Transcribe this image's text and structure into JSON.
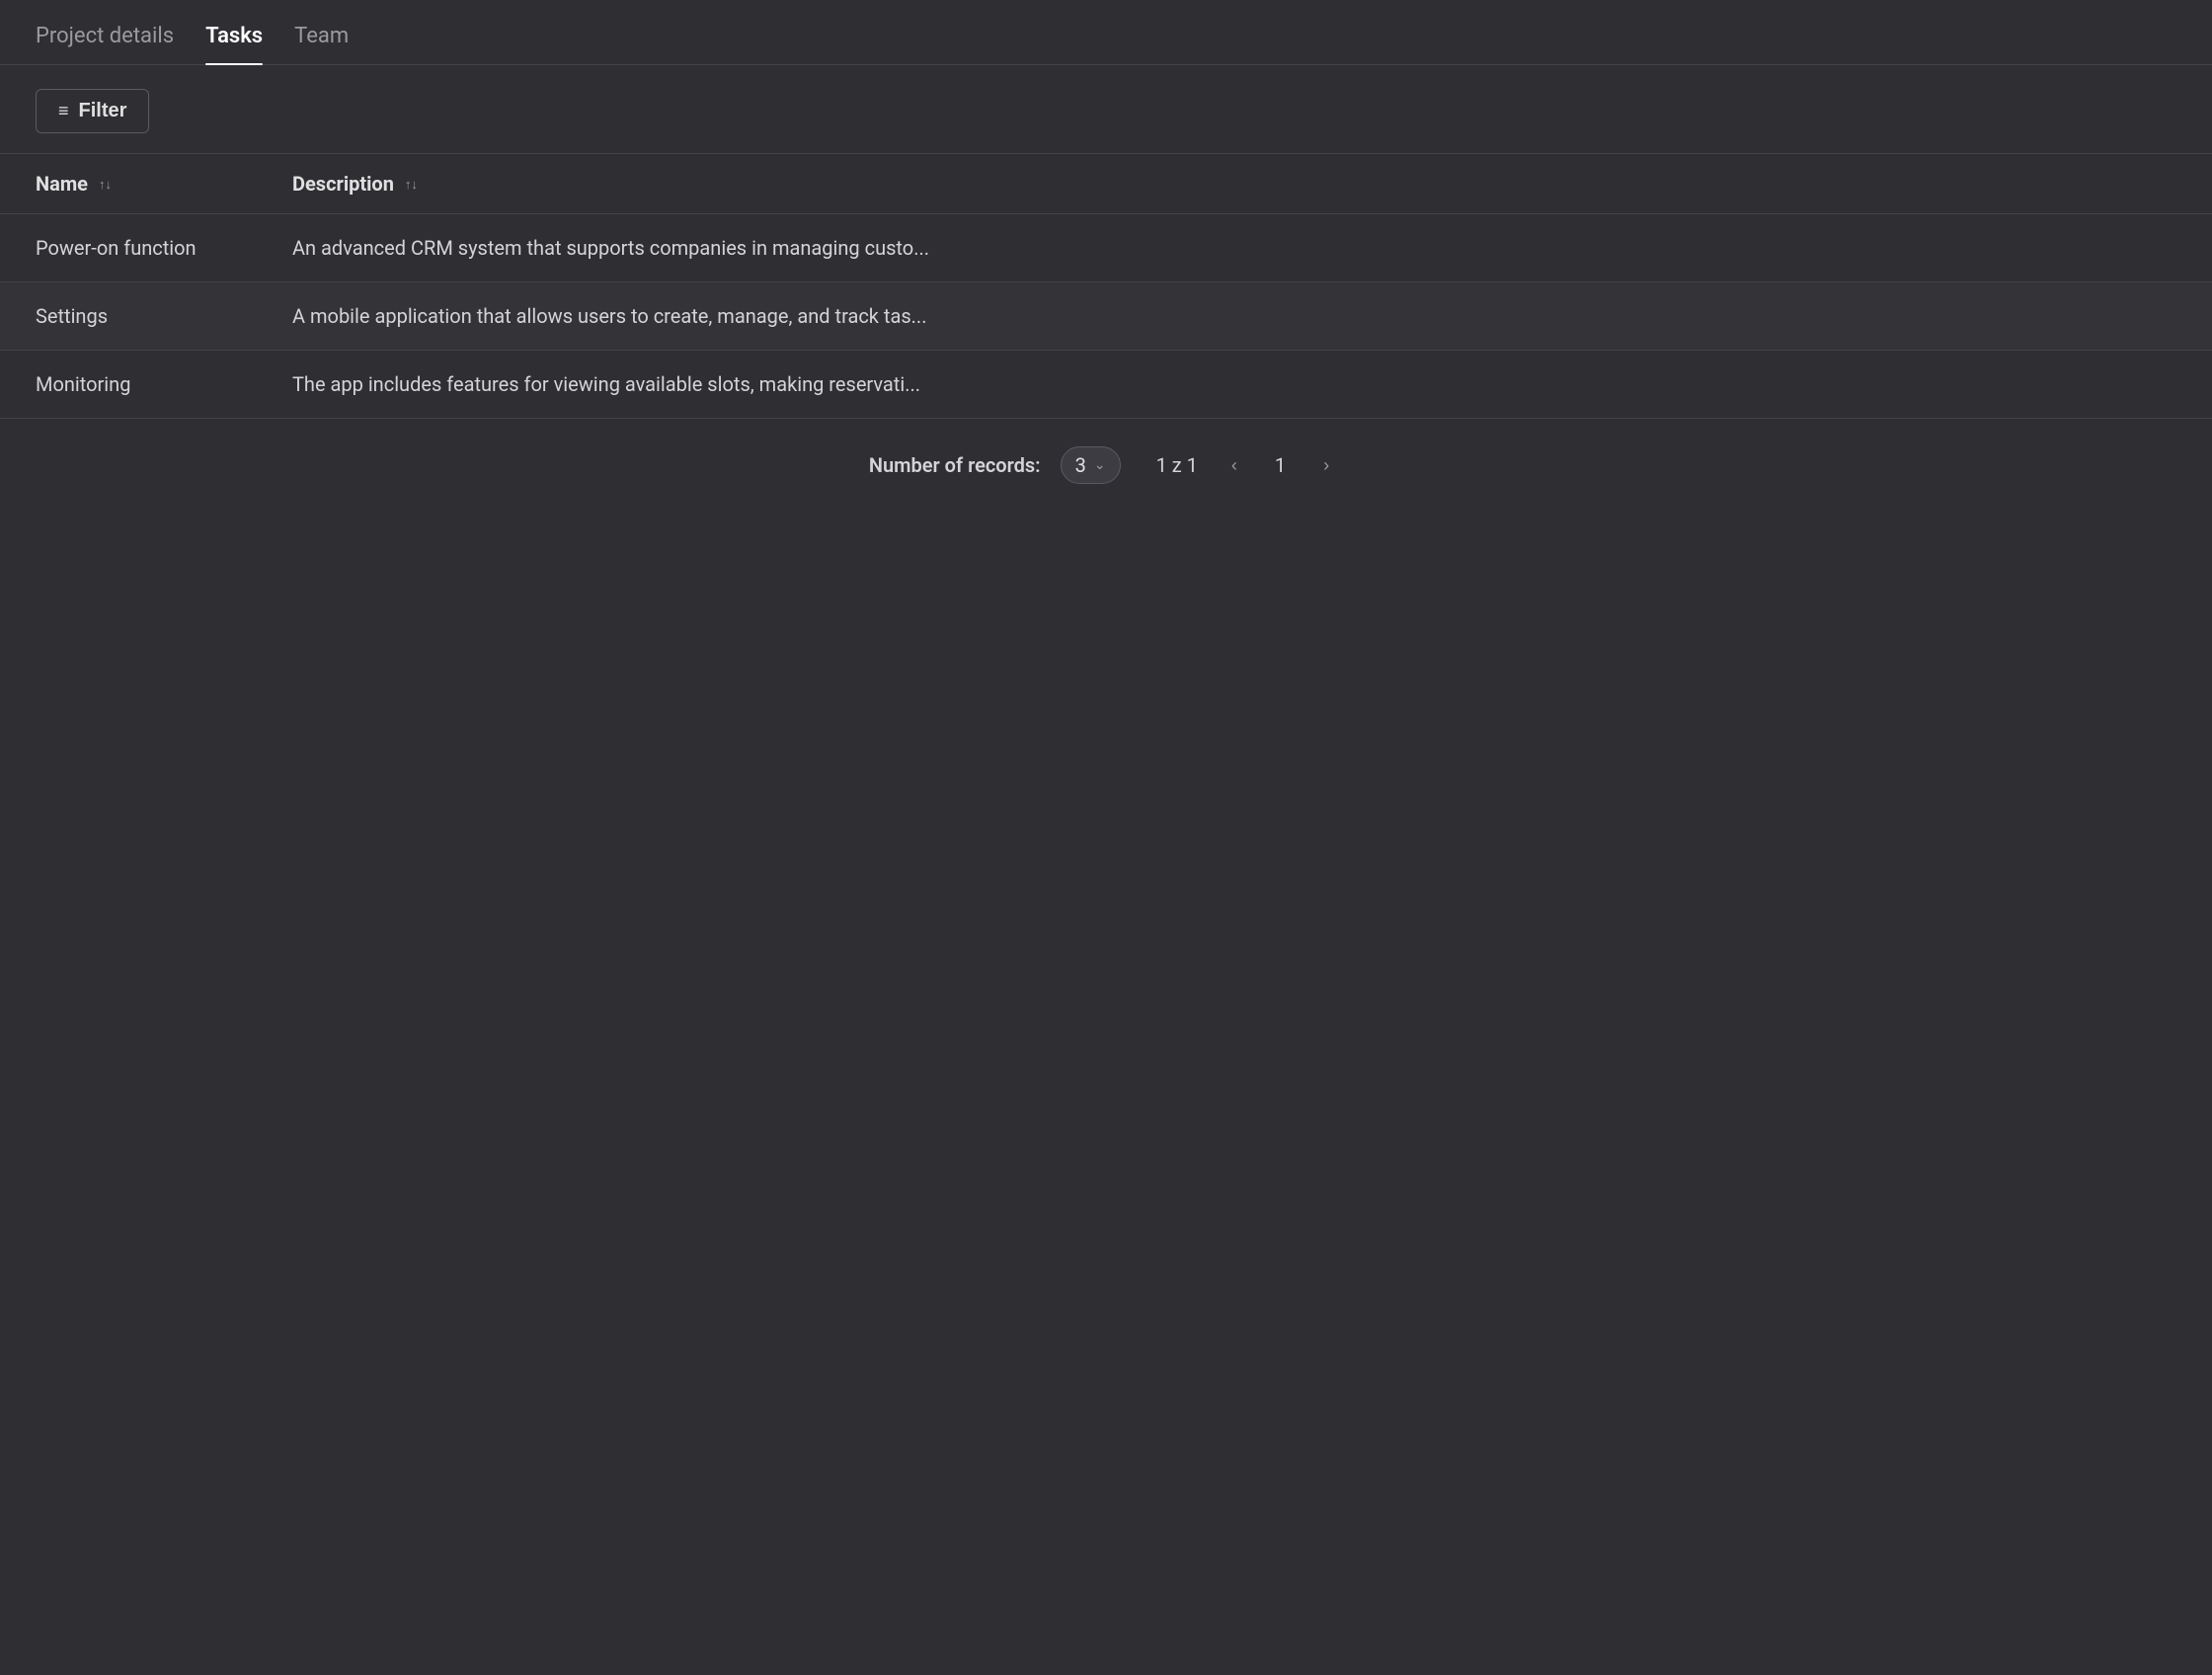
{
  "tabs": [
    {
      "id": "project-details",
      "label": "Project details",
      "active": false
    },
    {
      "id": "tasks",
      "label": "Tasks",
      "active": true
    },
    {
      "id": "team",
      "label": "Team",
      "active": false
    }
  ],
  "filter": {
    "button_label": "Filter",
    "icon": "≡"
  },
  "table": {
    "columns": [
      {
        "id": "name",
        "label": "Name",
        "sort_icon": "⇅"
      },
      {
        "id": "description",
        "label": "Description",
        "sort_icon": "⇅"
      }
    ],
    "rows": [
      {
        "name": "Power-on function",
        "description": "An advanced CRM system that supports companies in managing custo..."
      },
      {
        "name": "Settings",
        "description": "A mobile application that allows users to create, manage, and track tas..."
      },
      {
        "name": "Monitoring",
        "description": "The app includes features for viewing available slots, making reservati..."
      }
    ]
  },
  "pagination": {
    "records_label": "Number of records:",
    "records_count": "3",
    "page_info": "1 z 1",
    "current_page": "1"
  }
}
